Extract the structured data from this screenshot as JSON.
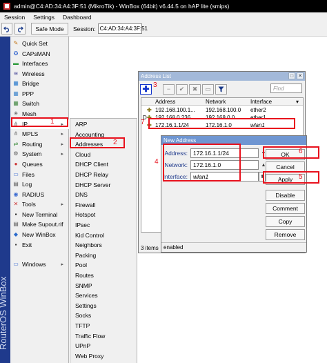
{
  "window": {
    "title": "admin@C4:AD:34:A4:3F:51 (MikroTik) - WinBox (64bit) v6.44.5 on hAP lite (smips)"
  },
  "menubar": [
    "Session",
    "Settings",
    "Dashboard"
  ],
  "toolbar": {
    "undo_icon": "undo-arrow",
    "redo_icon": "redo-arrow",
    "safe_mode": "Safe Mode",
    "session_label": "Session:",
    "session_value": "C4:AD:34:A4:3F:51"
  },
  "vertical_brand": "RouterOS WinBox",
  "sidebar": {
    "items": [
      {
        "label": "Quick Set",
        "icon": "quick-set-icon",
        "glyph": "✎",
        "color": "#c07010"
      },
      {
        "label": "CAPsMAN",
        "icon": "capsman-icon",
        "glyph": "✪",
        "color": "#3a6ad0"
      },
      {
        "label": "Interfaces",
        "icon": "interfaces-icon",
        "glyph": "▬",
        "color": "#2a9a3a"
      },
      {
        "label": "Wireless",
        "icon": "wireless-icon",
        "glyph": "≋",
        "color": "#4a4a9a"
      },
      {
        "label": "Bridge",
        "icon": "bridge-icon",
        "glyph": "▦",
        "color": "#2a7acc"
      },
      {
        "label": "PPP",
        "icon": "ppp-icon",
        "glyph": "▦",
        "color": "#4488cc"
      },
      {
        "label": "Switch",
        "icon": "switch-icon",
        "glyph": "▦",
        "color": "#448844"
      },
      {
        "label": "Mesh",
        "icon": "mesh-icon",
        "glyph": "✳",
        "color": "#444"
      },
      {
        "label": "IP",
        "icon": "ip-icon",
        "glyph": "⋔",
        "color": "#777",
        "arrow": true
      },
      {
        "label": "MPLS",
        "icon": "mpls-icon",
        "glyph": "⋔",
        "color": "#777",
        "arrow": true
      },
      {
        "label": "Routing",
        "icon": "routing-icon",
        "glyph": "⇄",
        "color": "#3a8a3a",
        "arrow": true
      },
      {
        "label": "System",
        "icon": "system-icon",
        "glyph": "⚙",
        "color": "#555",
        "arrow": true
      },
      {
        "label": "Queues",
        "icon": "queues-icon",
        "glyph": "●",
        "color": "#c33"
      },
      {
        "label": "Files",
        "icon": "files-icon",
        "glyph": "▭",
        "color": "#3a6ad0"
      },
      {
        "label": "Log",
        "icon": "log-icon",
        "glyph": "▤",
        "color": "#555"
      },
      {
        "label": "RADIUS",
        "icon": "radius-icon",
        "glyph": "◉",
        "color": "#3a6ad0"
      },
      {
        "label": "Tools",
        "icon": "tools-icon",
        "glyph": "✕",
        "color": "#cc3333",
        "arrow": true
      },
      {
        "label": "New Terminal",
        "icon": "terminal-icon",
        "glyph": "▪",
        "color": "#111"
      },
      {
        "label": "Make Supout.rif",
        "icon": "supout-icon",
        "glyph": "▤",
        "color": "#555"
      },
      {
        "label": "New WinBox",
        "icon": "winbox-icon",
        "glyph": "◆",
        "color": "#2a6acc"
      },
      {
        "label": "Exit",
        "icon": "exit-icon",
        "glyph": "▪",
        "color": "#333"
      },
      {
        "label": "Windows",
        "icon": "windows-icon",
        "glyph": "▭",
        "color": "#3a6ad0",
        "arrow": true
      }
    ]
  },
  "ip_submenu": [
    "ARP",
    "Accounting",
    "Addresses",
    "Cloud",
    "DHCP Client",
    "DHCP Relay",
    "DHCP Server",
    "DNS",
    "Firewall",
    "Hotspot",
    "IPsec",
    "Kid Control",
    "Neighbors",
    "Packing",
    "Pool",
    "Routes",
    "SNMP",
    "Services",
    "Settings",
    "Socks",
    "TFTP",
    "Traffic Flow",
    "UPnP",
    "Web Proxy"
  ],
  "address_list": {
    "title": "Address List",
    "find_placeholder": "Find",
    "columns": [
      "Address",
      "Network",
      "Interface"
    ],
    "rows": [
      {
        "address": "192.168.100.1...",
        "network": "192.168.100.0",
        "interface": "ether2"
      },
      {
        "address": "192.168.0.236...",
        "network": "192.168.0.0",
        "interface": "ether1"
      },
      {
        "address": "172.16.1.1/24",
        "network": "172.16.1.0",
        "interface": "wlan1"
      }
    ],
    "status": "3 items"
  },
  "new_address": {
    "title": "New Address",
    "address_label": "Address:",
    "address_value": "172.16.1.1/24",
    "network_label": "Network:",
    "network_value": "172.16.1.0",
    "interface_label": "Interface:",
    "interface_value": "wlan1",
    "buttons": {
      "ok": "OK",
      "cancel": "Cancel",
      "apply": "Apply",
      "disable": "Disable",
      "comment": "Comment",
      "copy": "Copy",
      "remove": "Remove"
    },
    "status": "enabled"
  },
  "annotations": [
    "1",
    "2",
    "3",
    "4",
    "5",
    "6",
    "7"
  ],
  "colors": {
    "annotation": "#e8101c",
    "brand_strip": "#1f3a8c",
    "titlebar": "#000000"
  }
}
